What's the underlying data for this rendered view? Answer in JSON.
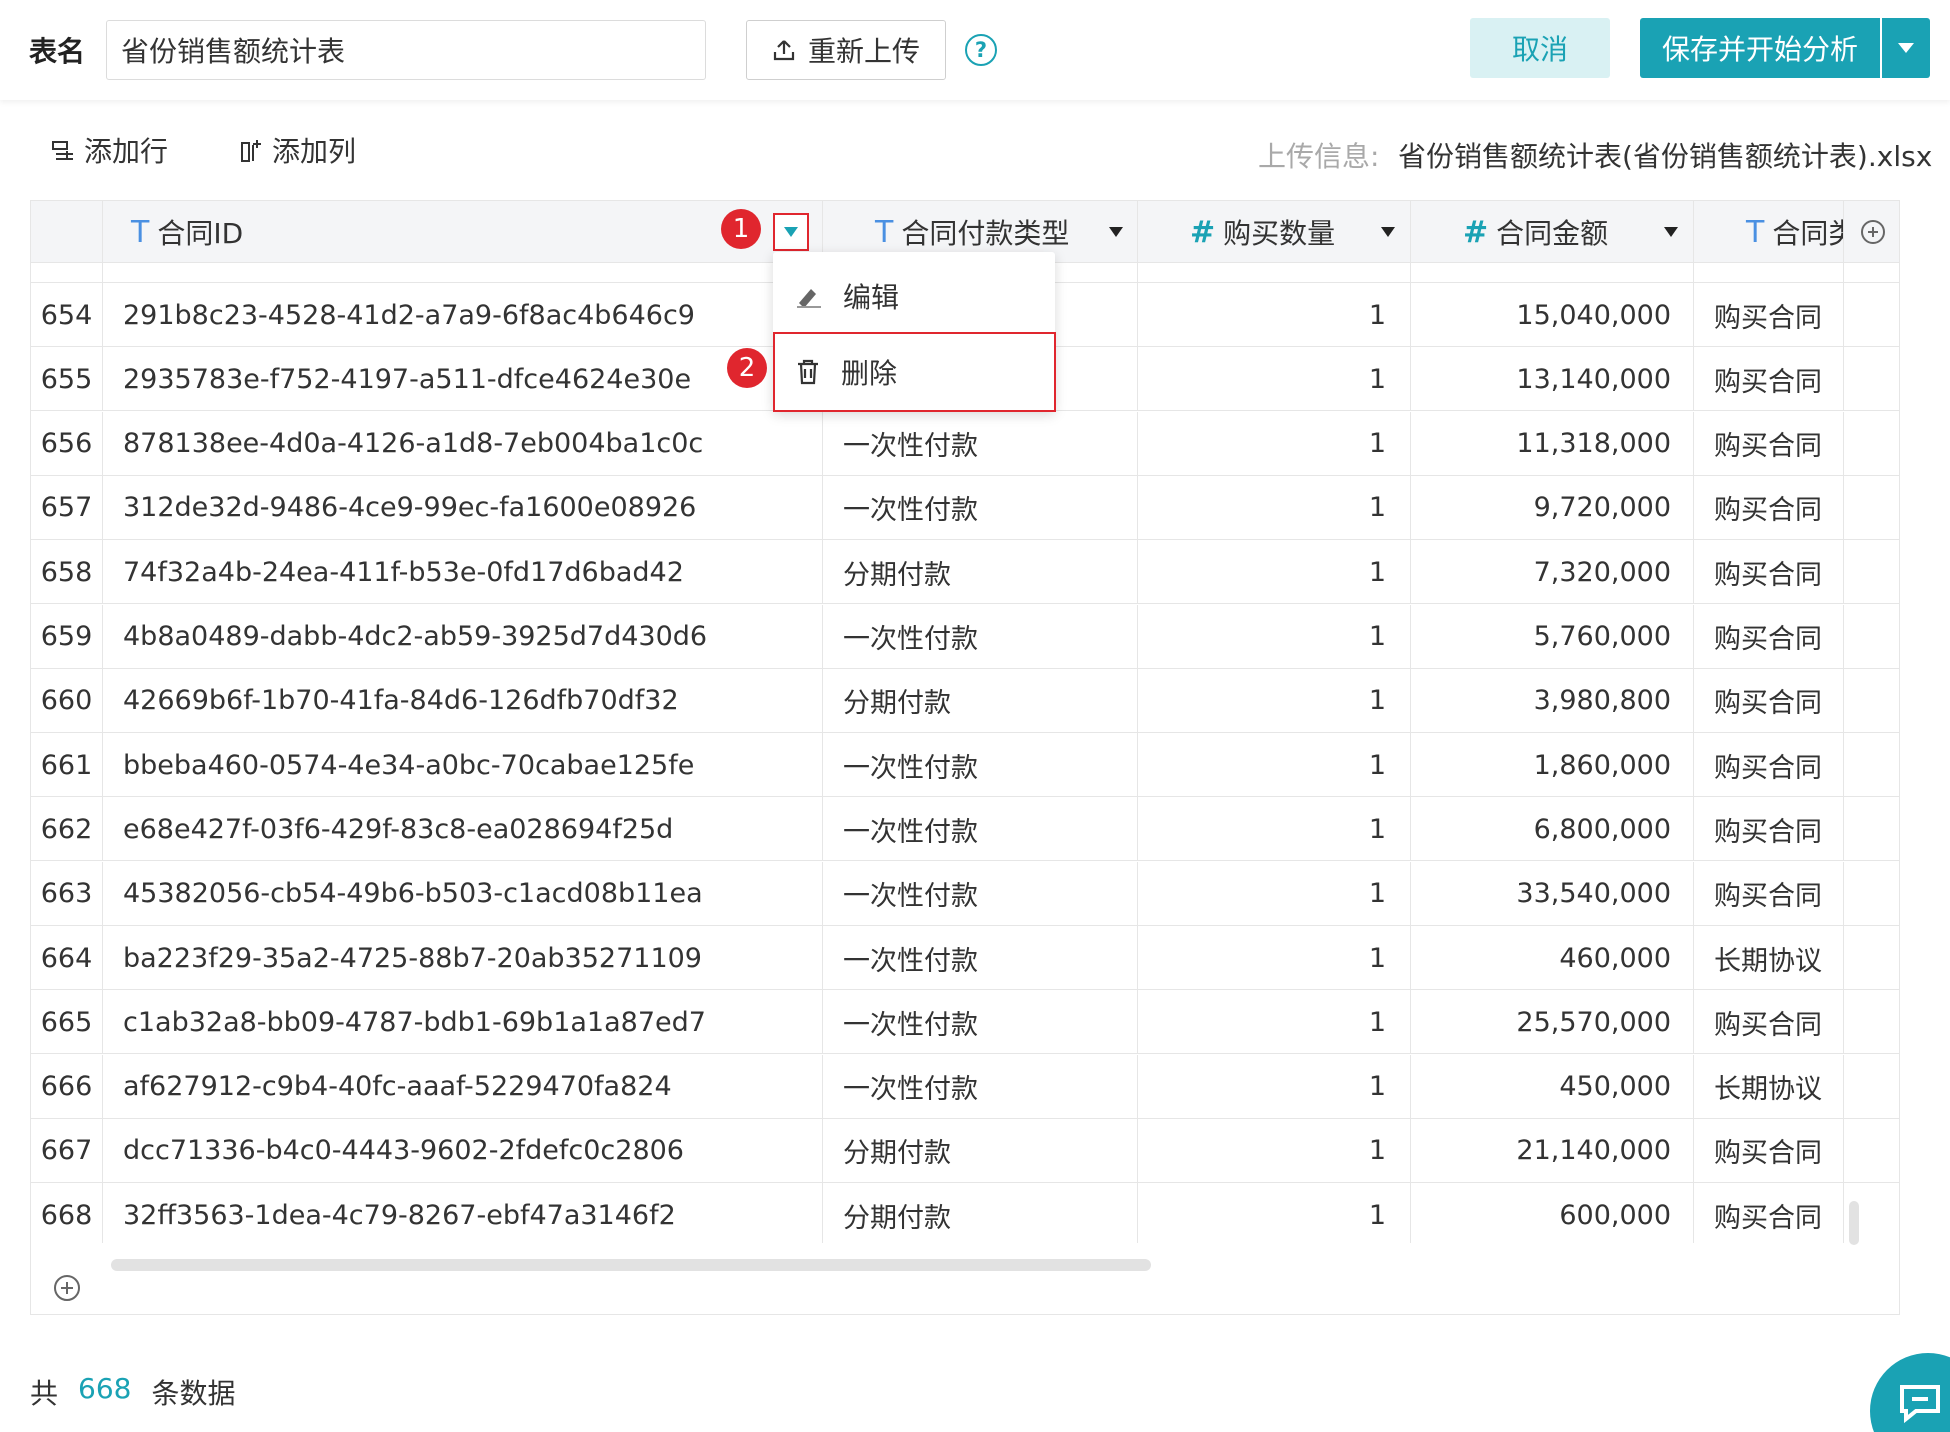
{
  "header": {
    "table_name_label": "表名",
    "table_name_value": "省份销售额统计表",
    "reupload_label": "重新上传",
    "help_glyph": "?",
    "cancel_label": "取消",
    "save_label": "保存并开始分析"
  },
  "toolbar": {
    "add_row_label": "添加行",
    "add_col_label": "添加列",
    "upload_info_label": "上传信息:",
    "upload_info_file": "省份销售额统计表(省份销售额统计表).xlsx"
  },
  "columns": [
    {
      "type": "T",
      "label": "合同ID"
    },
    {
      "type": "T",
      "label": "合同付款类型"
    },
    {
      "type": "#",
      "label": "购买数量"
    },
    {
      "type": "#",
      "label": "合同金额"
    },
    {
      "type": "T",
      "label": "合同类型"
    }
  ],
  "rows": [
    {
      "idx": "654",
      "id": "291b8c23-4528-41d2-a7a9-6f8ac4b646c9",
      "pay": "",
      "qty": "1",
      "amt": "15,040,000",
      "type": "购买合同"
    },
    {
      "idx": "655",
      "id": "2935783e-f752-4197-a511-dfce4624e30e",
      "pay": "",
      "qty": "1",
      "amt": "13,140,000",
      "type": "购买合同"
    },
    {
      "idx": "656",
      "id": "878138ee-4d0a-4126-a1d8-7eb004ba1c0c",
      "pay": "一次性付款",
      "qty": "1",
      "amt": "11,318,000",
      "type": "购买合同"
    },
    {
      "idx": "657",
      "id": "312de32d-9486-4ce9-99ec-fa1600e08926",
      "pay": "一次性付款",
      "qty": "1",
      "amt": "9,720,000",
      "type": "购买合同"
    },
    {
      "idx": "658",
      "id": "74f32a4b-24ea-411f-b53e-0fd17d6bad42",
      "pay": "分期付款",
      "qty": "1",
      "amt": "7,320,000",
      "type": "购买合同"
    },
    {
      "idx": "659",
      "id": "4b8a0489-dabb-4dc2-ab59-3925d7d430d6",
      "pay": "一次性付款",
      "qty": "1",
      "amt": "5,760,000",
      "type": "购买合同"
    },
    {
      "idx": "660",
      "id": "42669b6f-1b70-41fa-84d6-126dfb70df32",
      "pay": "分期付款",
      "qty": "1",
      "amt": "3,980,800",
      "type": "购买合同"
    },
    {
      "idx": "661",
      "id": "bbeba460-0574-4e34-a0bc-70cabae125fe",
      "pay": "一次性付款",
      "qty": "1",
      "amt": "1,860,000",
      "type": "购买合同"
    },
    {
      "idx": "662",
      "id": "e68e427f-03f6-429f-83c8-ea028694f25d",
      "pay": "一次性付款",
      "qty": "1",
      "amt": "6,800,000",
      "type": "购买合同"
    },
    {
      "idx": "663",
      "id": "45382056-cb54-49b6-b503-c1acd08b11ea",
      "pay": "一次性付款",
      "qty": "1",
      "amt": "33,540,000",
      "type": "购买合同"
    },
    {
      "idx": "664",
      "id": "ba223f29-35a2-4725-88b7-20ab35271109",
      "pay": "一次性付款",
      "qty": "1",
      "amt": "460,000",
      "type": "长期协议"
    },
    {
      "idx": "665",
      "id": "c1ab32a8-bb09-4787-bdb1-69b1a1a87ed7",
      "pay": "一次性付款",
      "qty": "1",
      "amt": "25,570,000",
      "type": "购买合同"
    },
    {
      "idx": "666",
      "id": "af627912-c9b4-40fc-aaaf-5229470fa824",
      "pay": "一次性付款",
      "qty": "1",
      "amt": "450,000",
      "type": "长期协议"
    },
    {
      "idx": "667",
      "id": "dcc71336-b4c0-4443-9602-2fdefc0c2806",
      "pay": "分期付款",
      "qty": "1",
      "amt": "21,140,000",
      "type": "购买合同"
    },
    {
      "idx": "668",
      "id": "32ff3563-1dea-4c79-8267-ebf47a3146f2",
      "pay": "分期付款",
      "qty": "1",
      "amt": "600,000",
      "type": "购买合同"
    }
  ],
  "menu": {
    "edit_label": "编辑",
    "delete_label": "删除"
  },
  "badges": [
    "1",
    "2"
  ],
  "footer": {
    "prefix": "共",
    "count": "668",
    "suffix": "条数据"
  },
  "colors": {
    "accent": "#1aa2b4",
    "highlight": "#e0262e",
    "text_type_icon": "#4a90e2"
  }
}
